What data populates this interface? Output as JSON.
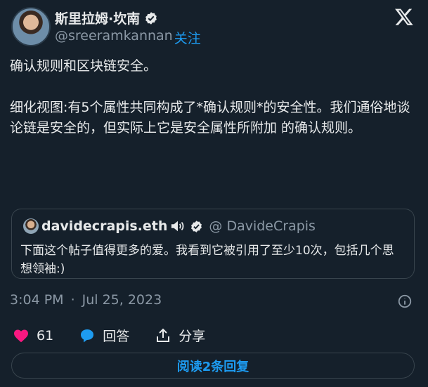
{
  "author": {
    "display_name": "斯里拉姆·坎南",
    "handle": "@sreeramkannan",
    "follow_label": "关注"
  },
  "tweet": {
    "paragraphs": [
      "确认规则和区块链安全。",
      "细化视图:有5个属性共同构成了*确认规则*的安全性。我们通俗地谈论链是安全的，但实际上它是安全属性所附加 的确认规则。"
    ]
  },
  "quote": {
    "name": "davidecrapis.eth",
    "handle": "@ DavideCrapis",
    "text": "下面这个帖子值得更多的爱。我看到它被引用了至少10次，包括几个思想领袖:)"
  },
  "meta": {
    "time": "3:04 PM",
    "separator": "·",
    "date": "Jul 25, 2023"
  },
  "actions": {
    "like_count": "61",
    "reply_label": "回答",
    "share_label": "分享"
  },
  "read_replies_label": "阅读2条回复",
  "colors": {
    "background": "#15202b",
    "accent": "#1d9bf0",
    "like": "#f91880",
    "muted": "#8b98a5"
  }
}
